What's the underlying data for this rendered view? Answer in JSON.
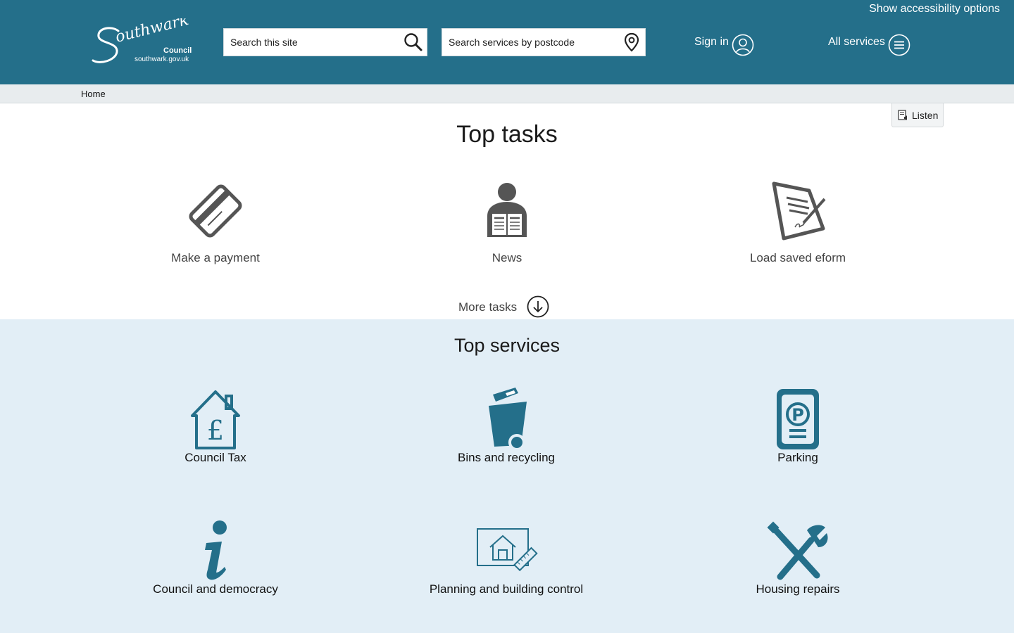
{
  "header": {
    "accessibility_label": "Show accessibility options",
    "logo": {
      "wordmark": "Southwark",
      "council": "Council",
      "url": "southwark.gov.uk"
    },
    "site_search": {
      "placeholder": "Search this site"
    },
    "postcode_search": {
      "placeholder": "Search services by postcode"
    },
    "sign_in_label": "Sign in",
    "all_services_label": "All services"
  },
  "breadcrumb": {
    "home": "Home"
  },
  "listen_label": "Listen",
  "top_tasks": {
    "title": "Top tasks",
    "items": [
      {
        "label": "Make a payment",
        "icon": "credit-card-icon"
      },
      {
        "label": "News",
        "icon": "newspaper-reader-icon"
      },
      {
        "label": "Load saved eform",
        "icon": "signed-document-icon"
      }
    ],
    "more_label": "More tasks"
  },
  "top_services": {
    "title": "Top services",
    "items": [
      {
        "label": "Council Tax",
        "icon": "house-pound-icon"
      },
      {
        "label": "Bins and recycling",
        "icon": "wheelie-bin-icon"
      },
      {
        "label": "Parking",
        "icon": "parking-meter-icon"
      },
      {
        "label": "Council and democracy",
        "icon": "info-icon"
      },
      {
        "label": "Planning and building control",
        "icon": "house-plan-icon"
      },
      {
        "label": "Housing repairs",
        "icon": "tools-icon"
      }
    ]
  },
  "colors": {
    "header": "#246f8a",
    "accent": "#246f8a",
    "services_bg": "#e2eef6",
    "task_icon": "#555555"
  }
}
